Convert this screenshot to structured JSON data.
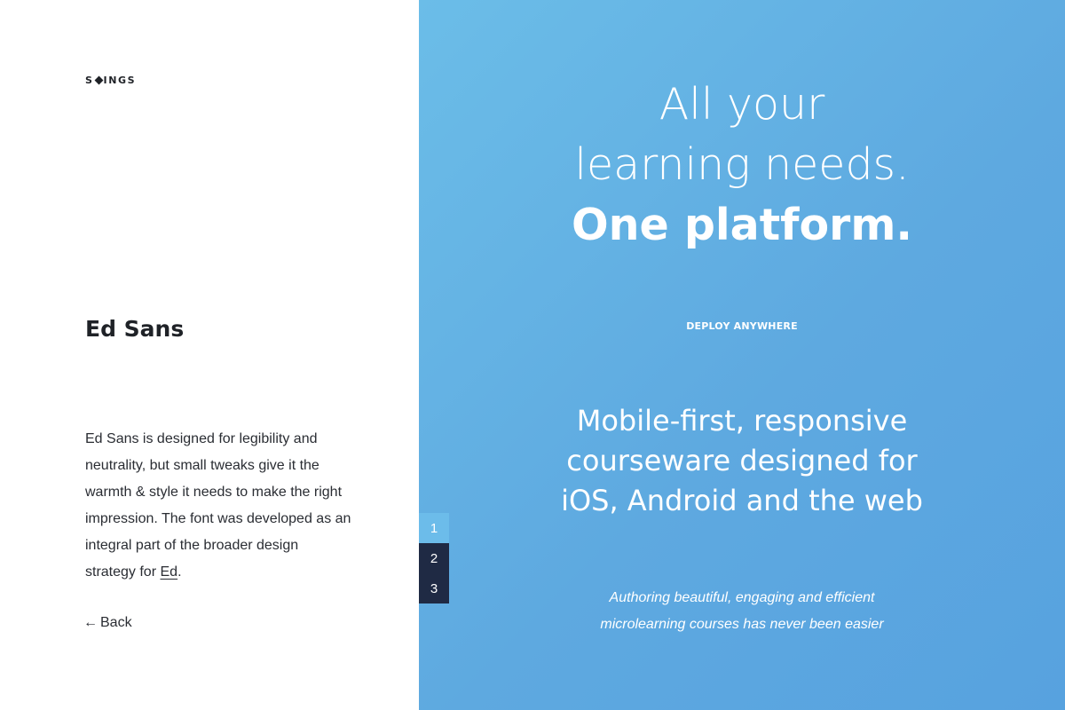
{
  "brand": {
    "logo_left": "S",
    "logo_right": "INGS"
  },
  "sidebar": {
    "title": "Ed Sans",
    "description_before_link": "Ed Sans is designed for legibility and neutrality, but small tweaks give it the warmth & style it needs to make the right impression. The font was developed as an integral part of the broader design strategy for ",
    "description_link": "Ed",
    "description_after_link": ".",
    "back_arrow": "←",
    "back_label": "Back"
  },
  "hero": {
    "line1": "All your",
    "line2": "learning needs.",
    "line3": "One platform.",
    "eyebrow": "DEPLOY ANYWHERE",
    "feature_line1": "Mobile-first, responsive",
    "feature_line2": "courseware designed for",
    "feature_line3": "iOS, Android and the web",
    "tagline_line1": "Authoring beautiful, engaging and efficient",
    "tagline_line2": "microlearning courses has never been easier"
  },
  "pager": {
    "pages": [
      "1",
      "2",
      "3"
    ],
    "active_index": 0
  },
  "colors": {
    "panel_blue": "#5ea9e0",
    "pager_active": "#6cbcea",
    "pager_inactive": "#1f2a44",
    "text_dark": "#1f2227"
  },
  "icons": {
    "back": "arrow-left-icon",
    "logo_mark": "diamond-icon"
  }
}
